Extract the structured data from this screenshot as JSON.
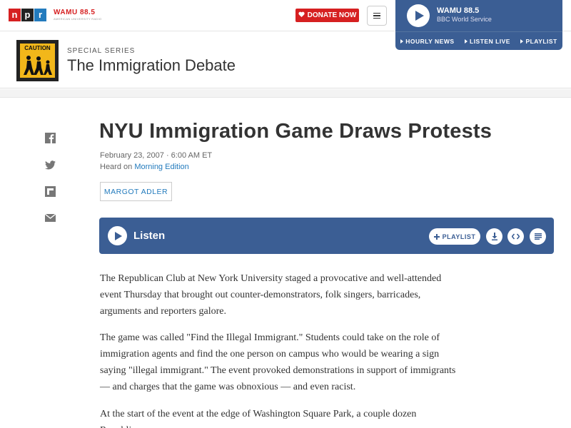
{
  "header": {
    "npr_letters": [
      "n",
      "p",
      "r"
    ],
    "station_name": "WAMU 88.5",
    "station_tagline": "AMERICAN UNIVERSITY RADIO",
    "donate_label": "DONATE NOW"
  },
  "player": {
    "title": "WAMU 88.5",
    "subtitle": "BBC World Service",
    "links": [
      "HOURLY NEWS",
      "LISTEN LIVE",
      "PLAYLIST"
    ]
  },
  "series": {
    "label": "SPECIAL SERIES",
    "title": "The Immigration Debate",
    "image_sign_text": "CAUTION"
  },
  "article": {
    "headline": "NYU Immigration Game Draws Protests",
    "date": "February 23, 2007 · 6:00 AM ET",
    "heard_prefix": "Heard on ",
    "program": "Morning Edition",
    "byline": "MARGOT ADLER",
    "listen_label": "Listen",
    "playlist_label": "PLAYLIST",
    "paragraphs": [
      "The Republican Club at New York University staged a provocative and well-attended event Thursday that brought out counter-demonstrators, folk singers, barricades, arguments and reporters galore.",
      "The game was called \"Find the Illegal Immigrant.\" Students could take on the role of immigration agents and find the one person on campus who would be wearing a sign saying \"illegal immigrant.\" The event provoked demonstrations in support of immigrants — and charges that the game was obnoxious — and even racist.",
      "At the start of the event at the edge of Washington Square Park, a couple dozen Republican"
    ]
  },
  "colors": {
    "npr_red": "#d62021",
    "npr_blue": "#237bbd",
    "player_blue": "#3b5e94"
  }
}
